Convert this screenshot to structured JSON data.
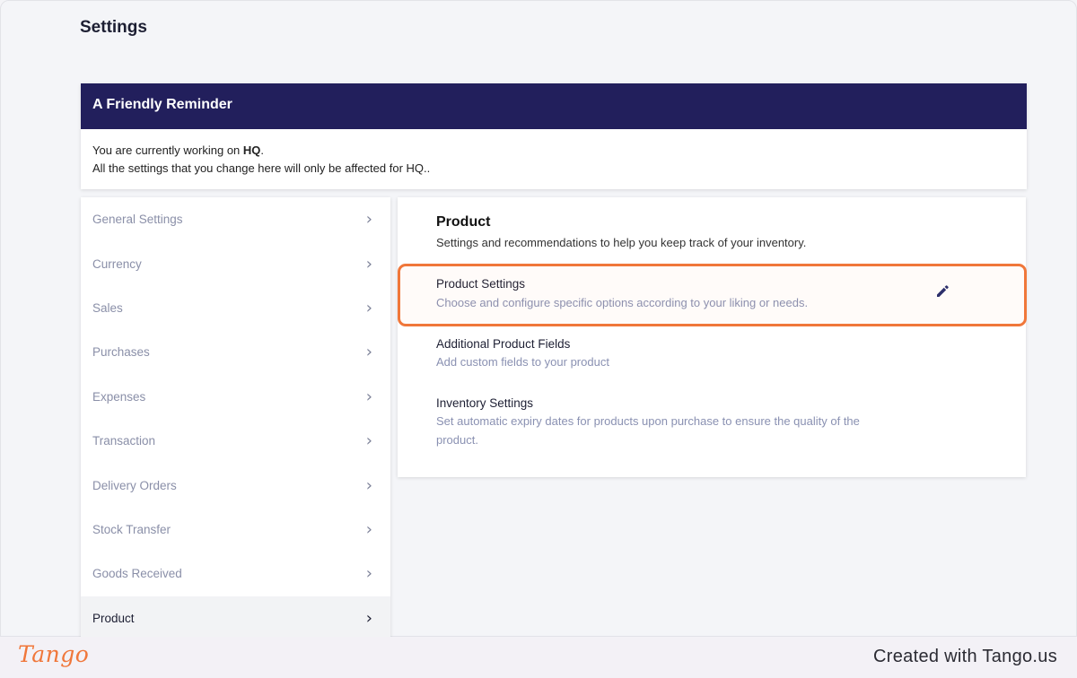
{
  "page": {
    "title": "Settings"
  },
  "reminder": {
    "title": "A Friendly Reminder",
    "line1_prefix": "You are currently working on ",
    "line1_branch": "HQ",
    "line1_suffix": ".",
    "line2": "All the settings that you change here will only be affected for HQ.."
  },
  "sidebar": {
    "items": [
      {
        "label": "General Settings"
      },
      {
        "label": "Currency"
      },
      {
        "label": "Sales"
      },
      {
        "label": "Purchases"
      },
      {
        "label": "Expenses"
      },
      {
        "label": "Transaction"
      },
      {
        "label": "Delivery Orders"
      },
      {
        "label": "Stock Transfer"
      },
      {
        "label": "Goods Received"
      },
      {
        "label": "Product",
        "active": true
      }
    ],
    "chevron": "›"
  },
  "content": {
    "title": "Product",
    "subtitle": "Settings and recommendations to help you keep track of your inventory.",
    "rows": [
      {
        "title": "Product Settings",
        "description": "Choose and configure specific options according to your liking or needs.",
        "highlighted": true
      },
      {
        "title": "Additional Product Fields",
        "description": "Add custom fields to your product"
      },
      {
        "title": "Inventory Settings",
        "description": "Set automatic expiry dates for products upon purchase to ensure the quality of the product."
      }
    ]
  },
  "icons": {
    "edit": "pencil-icon",
    "chevron": "chevron-right-icon"
  },
  "footer": {
    "logo": "Tango",
    "credit": "Created with Tango.us"
  },
  "colors": {
    "header_bg": "#221f5c",
    "highlight": "#f0773a",
    "muted_text": "#8a91b2",
    "pencil": "#2d2f6b"
  }
}
